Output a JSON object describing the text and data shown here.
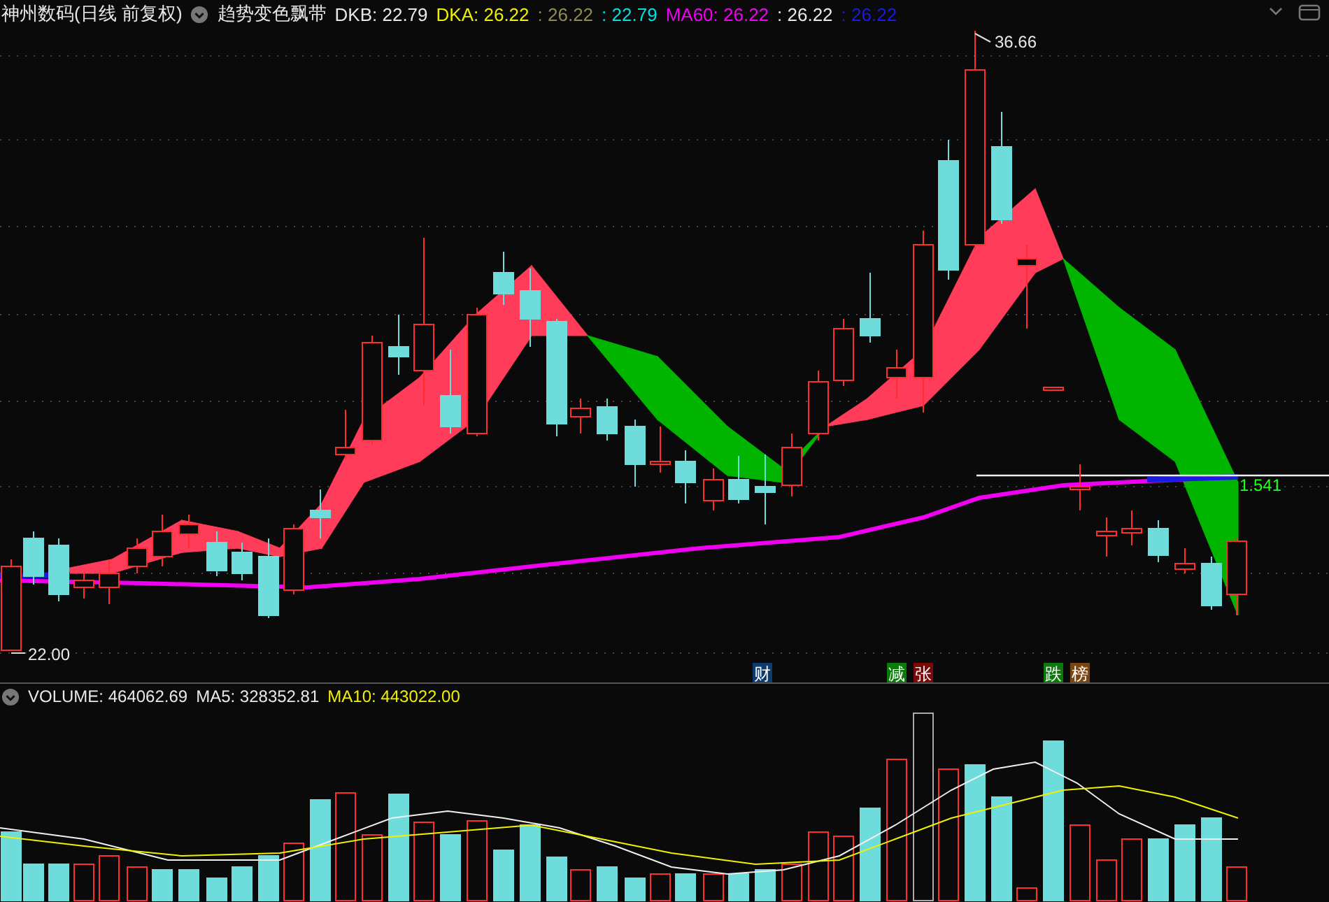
{
  "header": {
    "stock": "神州数码(日线 前复权)",
    "indicator": "趋势变色飘带",
    "legend": [
      {
        "text": "DKB: 22.79",
        "color": "#e8e8e8"
      },
      {
        "text": "DKA: 26.22",
        "color": "#f0f000"
      },
      {
        "text": ": 26.22",
        "color": "#8c8c50"
      },
      {
        "text": ": 22.79",
        "color": "#00e0e0"
      },
      {
        "text": "MA60: 26.22",
        "color": "#f000f0"
      },
      {
        "text": ": 26.22",
        "color": "#e8e8e8"
      },
      {
        "text": ": 26.22",
        "color": "#1a1ae0"
      }
    ]
  },
  "chart": {
    "high_label": "36.66",
    "low_label": "22.00",
    "value_label": "1.541",
    "markers": [
      {
        "text": "财",
        "color": "#0f3a6e"
      },
      {
        "text": "减",
        "color": "#0a7a0a"
      },
      {
        "text": "张",
        "color": "#7a0a0a"
      },
      {
        "text": "跌",
        "color": "#0a7a0a"
      },
      {
        "text": "榜",
        "color": "#7a4510"
      }
    ]
  },
  "volume": {
    "legend": [
      {
        "text": "VOLUME: 464062.69",
        "color": "#e8e8e8"
      },
      {
        "text": "MA5: 328352.81",
        "color": "#e8e8e8"
      },
      {
        "text": "MA10: 443022.00",
        "color": "#f0f000"
      }
    ]
  }
}
